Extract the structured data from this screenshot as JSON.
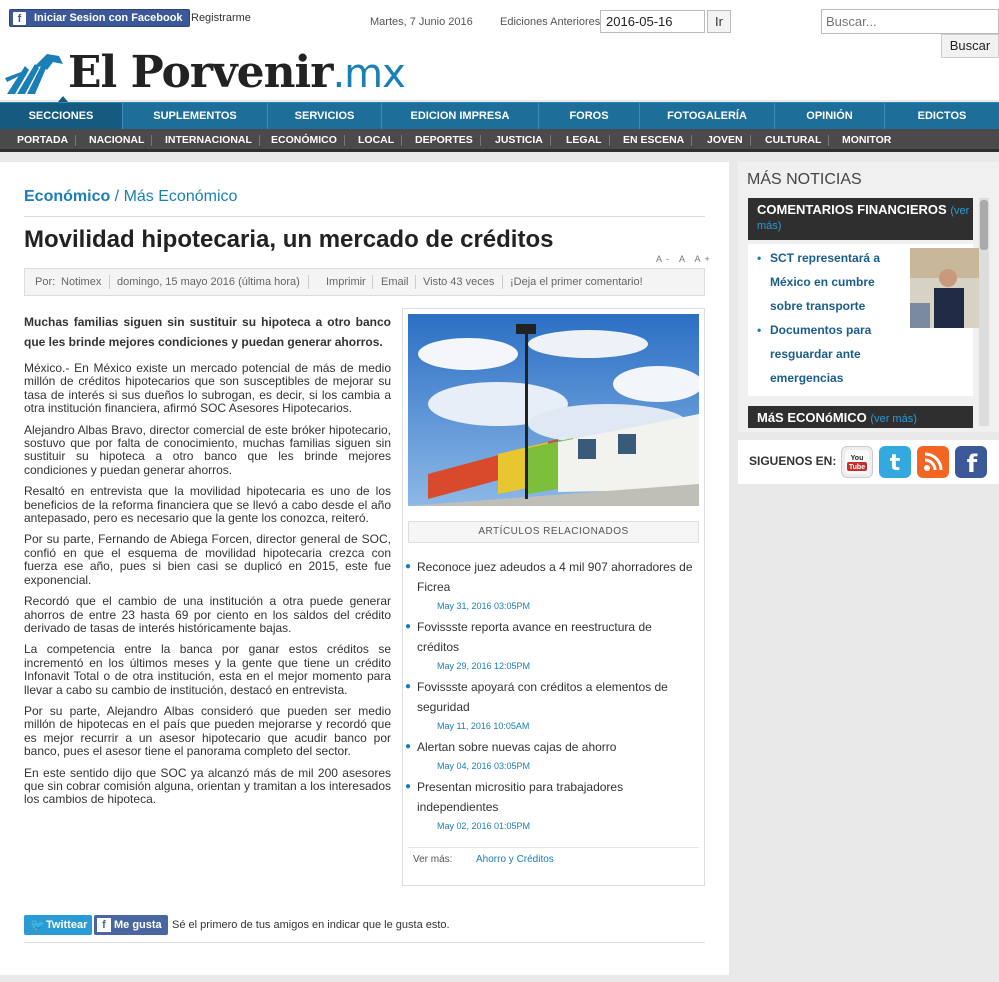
{
  "topbar": {
    "fb_login_label": "Iniciar Sesion con Facebook",
    "register_label": "Registrarme",
    "date": "Martes, 7 Junio 2016",
    "editions_label": "Ediciones Anteriores",
    "edition_value": "2016-05-16",
    "edition_button": "Ir",
    "search_placeholder": "Buscar...",
    "search_button": "Buscar"
  },
  "logo": {
    "name": "El Porvenir",
    "suffix": ".mx"
  },
  "nav_main": [
    "SECCIONES",
    "SUPLEMENTOS",
    "SERVICIOS",
    "EDICION IMPRESA",
    "FOROS",
    "FOTOGALERÍA",
    "OPINIÓN",
    "EDICTOS"
  ],
  "nav_sub": [
    "PORTADA",
    "NACIONAL",
    "INTERNACIONAL",
    "ECONÓMICO",
    "LOCAL",
    "DEPORTES",
    "JUSTICIA",
    "LEGAL",
    "EN ESCENA",
    "JOVEN",
    "CULTURAL",
    "MONITOR"
  ],
  "article": {
    "breadcrumb_section": "Económico",
    "breadcrumb_sep": " / ",
    "breadcrumb_sub": "Más Económico",
    "title": "Movilidad hipotecaria, un mercado de créditos",
    "font_controls": "A- A A+",
    "meta": {
      "by_label": "Por:",
      "author": "Notimex",
      "date": "domingo, 15 mayo 2016 (última hora)",
      "print": "Imprimir",
      "email": "Email",
      "views": "Visto 43 veces",
      "comment": "¡Deja el primer comentario!"
    },
    "lead": "Muchas familias siguen sin sustituir su hipoteca a otro banco que les brinde mejores condiciones y puedan generar ahorros.",
    "paragraphs": [
      "México.- En México existe un mercado potencial de más de medio millón de créditos hipotecarios que son susceptibles de mejorar su tasa de interés si sus dueños lo subrogan, es decir, si los cambia a otra institución financiera, afirmó SOC Asesores Hipotecarios.",
      "Alejandro Albas Bravo, director comercial de este bróker hipotecario, sostuvo que por falta de conocimiento, muchas familias siguen sin sustituir su hipoteca a otro banco que les brinde mejores condiciones y puedan generar ahorros.",
      "Resaltó en entrevista que la movilidad hipotecaria es uno de los beneficios de la reforma financiera que se llevó a cabo desde el año antepasado, pero es necesario que la gente los conozca, reiteró.",
      "Por su parte, Fernando de Abiega Forcen, director general de SOC, confió en que el esquema de movilidad hipotecaria crezca con fuerza ese año, pues si bien casi se duplicó en 2015, este fue exponencial.",
      "Recordó que el cambio de una institución a otra puede generar ahorros de entre 23 hasta 69 por ciento en los saldos del crédito derivado de tasas de interés históricamente bajas.",
      "La competencia entre la banca por ganar estos créditos se incrementó en los últimos meses y la gente que tiene un crédito Infonavit Total o de otra institución, esta en el mejor momento para llevar a cabo su cambio de institución, destacó en entrevista.",
      "Por su parte, Alejandro Albas consideró que pueden ser medio millón de hipotecas en el país que pueden mejorarse y recordó que es mejor recurrir a un asesor hipotecario que acudir banco por banco, pues el asesor tiene el panorama completo del sector.",
      "En este sentido dijo que SOC ya alcanzó más de mil 200 asesores que sin cobrar comisión alguna, orientan y tramitan a los interesados los cambios de hipoteca."
    ]
  },
  "related": {
    "heading": "ARTÍCULOS RELACIONADOS",
    "items": [
      {
        "title": "Reconoce juez adeudos a 4 mil 907 ahorradores de Ficrea",
        "date": "May 31, 2016 03:05PM"
      },
      {
        "title": "Fovissste reporta avance en reestructura de créditos",
        "date": "May 29, 2016 12:05PM"
      },
      {
        "title": "Fovissste apoyará con créditos a elementos de seguridad",
        "date": "May 11, 2016 10:05AM"
      },
      {
        "title": "Alertan sobre nuevas cajas de ahorro",
        "date": "May 04, 2016 03:05PM"
      },
      {
        "title": "Presentan micrositio para trabajadores independientes",
        "date": "May 02, 2016 01:05PM"
      }
    ],
    "see_more_label": "Ver más:",
    "see_more_link": "Ahorro y Créditos"
  },
  "share": {
    "twitter_label": "Twittear",
    "like_label": "Me gusta",
    "like_text": "Sé el primero de tus amigos en indicar que le gusta esto."
  },
  "sidebar": {
    "more_news_title": "MÁS NOTICIAS",
    "financial_comments_title": "COMENTARIOS FINANCIEROS",
    "financial_see_more": "(ver más)",
    "financial_items": [
      "SCT representará a México en cumbre sobre transporte",
      "Documentos para resguardar ante emergencias"
    ],
    "more_economic_title": "MáS ECONóMICO",
    "more_economic_see_more": "(ver más)",
    "follow_label": "SIGUENOS EN:",
    "social": [
      {
        "name": "youtube",
        "label": "You Tube",
        "color": "#c4302b"
      },
      {
        "name": "twitter",
        "label": "t",
        "color": "#33a9e0"
      },
      {
        "name": "rss",
        "label": "rss",
        "color": "#f26522"
      },
      {
        "name": "facebook",
        "label": "f",
        "color": "#3b5998"
      }
    ]
  },
  "colors": {
    "nav_blue": "#1d6e99",
    "nav_dark": "#4a4a4a",
    "link_blue": "#1a7fb5"
  }
}
